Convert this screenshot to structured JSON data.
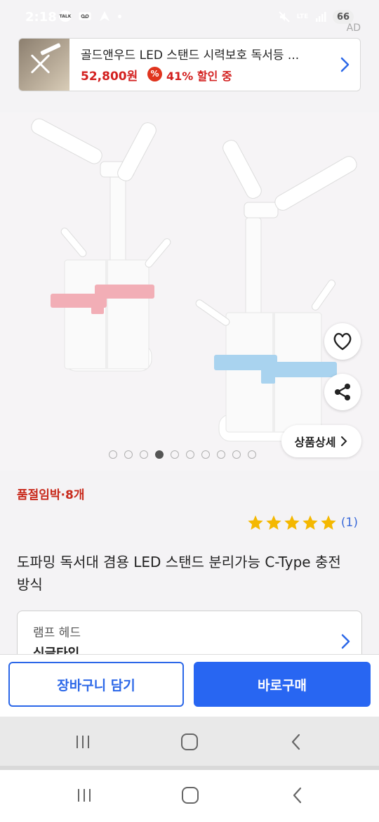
{
  "status_bar": {
    "time": "2:18",
    "left_icons": [
      "talk-icon",
      "voicemail-icon",
      "navigation-icon",
      "dot-icon"
    ],
    "right_icons": [
      "mute-icon",
      "lte-icon",
      "signal-icon"
    ],
    "battery": "66",
    "network": "LTE"
  },
  "ad": {
    "tag": "AD",
    "title": "골드앤우드 LED 스탠드 시력보호 독서등 ...",
    "price": "52,800원",
    "discount": "41% 할인 중",
    "pct_symbol": "%"
  },
  "gallery": {
    "detail_button": "상품상세",
    "page_count": 10,
    "active_index": 3
  },
  "product": {
    "stock_notice": "품절임박·8개",
    "rating_stars": 5,
    "rating_count": "(1)",
    "title": "도파밍 독서대 겸용 LED 스탠드 분리가능 C-Type 충전방식",
    "option_label": "램프 헤드",
    "option_value": "싱글타입"
  },
  "actions": {
    "cart": "장바구니 담기",
    "buy": "바로구매"
  },
  "colors": {
    "accent_blue": "#2866f2",
    "sale_red": "#d3201f",
    "star_yellow": "#f4b800"
  }
}
